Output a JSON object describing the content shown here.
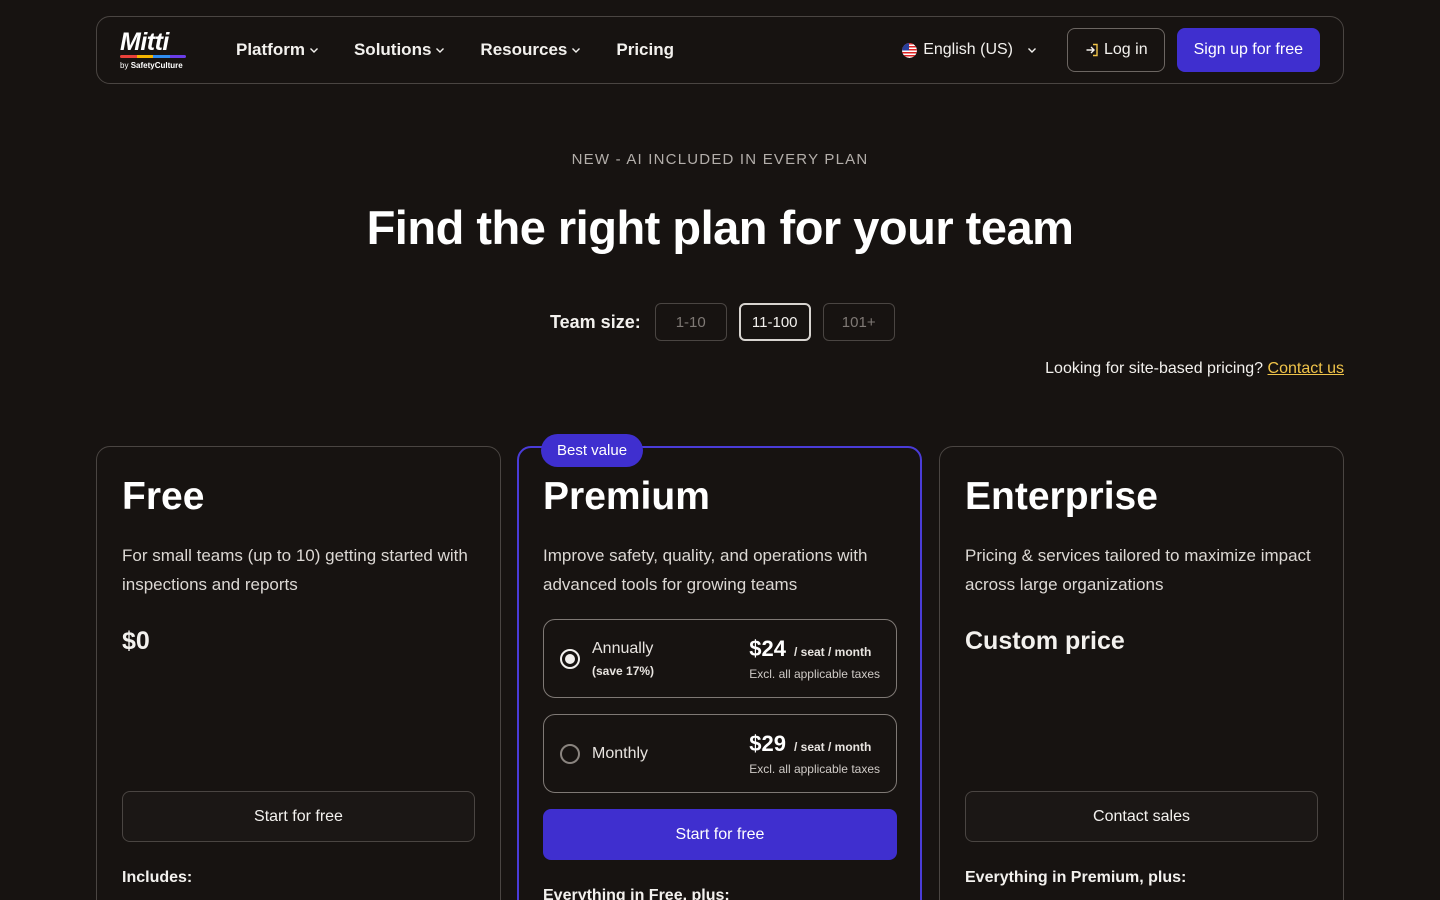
{
  "nav": {
    "logo": "Mitti",
    "logo_by": "by",
    "logo_company": "SafetyCulture",
    "menu": [
      {
        "label": "Platform",
        "has_dropdown": true
      },
      {
        "label": "Solutions",
        "has_dropdown": true
      },
      {
        "label": "Resources",
        "has_dropdown": true
      },
      {
        "label": "Pricing",
        "has_dropdown": false
      }
    ],
    "language": "English (US)",
    "login": "Log in",
    "signup": "Sign up for free"
  },
  "hero": {
    "eyebrow": "NEW - AI INCLUDED IN EVERY PLAN",
    "title": "Find the right plan for your team",
    "team_size_label": "Team size:",
    "team_sizes": [
      {
        "label": "1-10",
        "selected": false
      },
      {
        "label": "11-100",
        "selected": true
      },
      {
        "label": "101+",
        "selected": false
      }
    ],
    "site_pricing_text": "Looking for site-based pricing?",
    "site_pricing_link": "Contact us"
  },
  "plans": {
    "free": {
      "name": "Free",
      "description": "For small teams (up to 10) getting started with inspections and reports",
      "price": "$0",
      "cta": "Start for free",
      "includes": "Includes:"
    },
    "premium": {
      "badge": "Best value",
      "name": "Premium",
      "description": "Improve safety, quality, and operations with advanced tools for growing teams",
      "options": [
        {
          "label": "Annually",
          "note": "(save 17%)",
          "price": "$24",
          "unit": "/ seat / month",
          "tax": "Excl. all applicable taxes",
          "selected": true
        },
        {
          "label": "Monthly",
          "note": "",
          "price": "$29",
          "unit": "/ seat / month",
          "tax": "Excl. all applicable taxes",
          "selected": false
        }
      ],
      "cta": "Start for free",
      "includes": "Everything in Free, plus:"
    },
    "enterprise": {
      "name": "Enterprise",
      "description": "Pricing & services tailored to maximize impact across large organizations",
      "price": "Custom price",
      "cta": "Contact sales",
      "includes": "Everything in Premium, plus:"
    }
  },
  "colors": {
    "background": "#171311",
    "accent": "#3f2fcf",
    "link": "#f0c44a"
  }
}
